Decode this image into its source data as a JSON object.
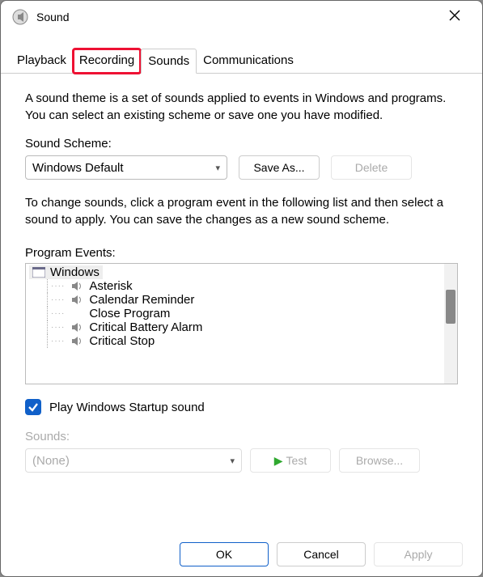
{
  "window": {
    "title": "Sound"
  },
  "tabs": {
    "playback": "Playback",
    "recording": "Recording",
    "sounds": "Sounds",
    "communications": "Communications",
    "highlighted": "recording",
    "active": "sounds"
  },
  "intro": "A sound theme is a set of sounds applied to events in Windows and programs.  You can select an existing scheme or save one you have modified.",
  "scheme": {
    "label": "Sound Scheme:",
    "selected": "Windows Default",
    "save_as": "Save As...",
    "delete": "Delete"
  },
  "change_hint": "To change sounds, click a program event in the following list and then select a sound to apply.  You can save the changes as a new sound scheme.",
  "events": {
    "label": "Program Events:",
    "root": "Windows",
    "items": [
      {
        "label": "Asterisk",
        "has_sound": true
      },
      {
        "label": "Calendar Reminder",
        "has_sound": true
      },
      {
        "label": "Close Program",
        "has_sound": false
      },
      {
        "label": "Critical Battery Alarm",
        "has_sound": true
      },
      {
        "label": "Critical Stop",
        "has_sound": true
      }
    ]
  },
  "startup": {
    "checked": true,
    "label": "Play Windows Startup sound"
  },
  "sounds": {
    "label": "Sounds:",
    "selected": "(None)",
    "test": "Test",
    "browse": "Browse...",
    "enabled": false
  },
  "footer": {
    "ok": "OK",
    "cancel": "Cancel",
    "apply": "Apply"
  }
}
